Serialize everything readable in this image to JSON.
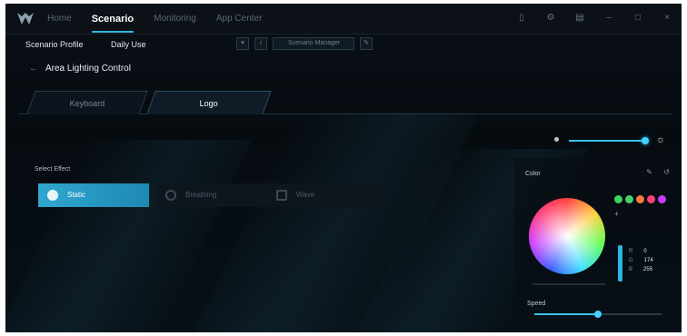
{
  "nav": {
    "items": [
      "Home",
      "Scenario",
      "Monitoring",
      "App Center"
    ],
    "active_index": 1
  },
  "window_controls": [
    "device-icon",
    "settings-icon",
    "menu-icon",
    "minimize-icon",
    "maximize-icon",
    "close-icon"
  ],
  "profile": {
    "label": "Scenario Profile",
    "name": "Daily Use",
    "manager_label": "Scenario Manager"
  },
  "breadcrumb": {
    "back_label": "Area Lighting Control"
  },
  "tabs": [
    {
      "label": "Keyboard",
      "active": false
    },
    {
      "label": "Logo",
      "active": true
    }
  ],
  "brightness": {
    "value_fraction": 0.96
  },
  "effect": {
    "label": "Select Effect",
    "options": [
      "Static",
      "Breathing",
      "Wave"
    ],
    "selected_index": 0
  },
  "color_panel": {
    "label": "Color",
    "swatches": [
      "#3fd35f",
      "#43d46a",
      "#ff7a3c",
      "#ff3d7a",
      "#c73dff"
    ],
    "rgb": [
      {
        "label": "R",
        "value": "0"
      },
      {
        "label": "G",
        "value": "174"
      },
      {
        "label": "B",
        "value": "255"
      }
    ],
    "accent_color": "#2fb6e0"
  },
  "speed": {
    "label": "Speed",
    "value_fraction": 0.5
  }
}
